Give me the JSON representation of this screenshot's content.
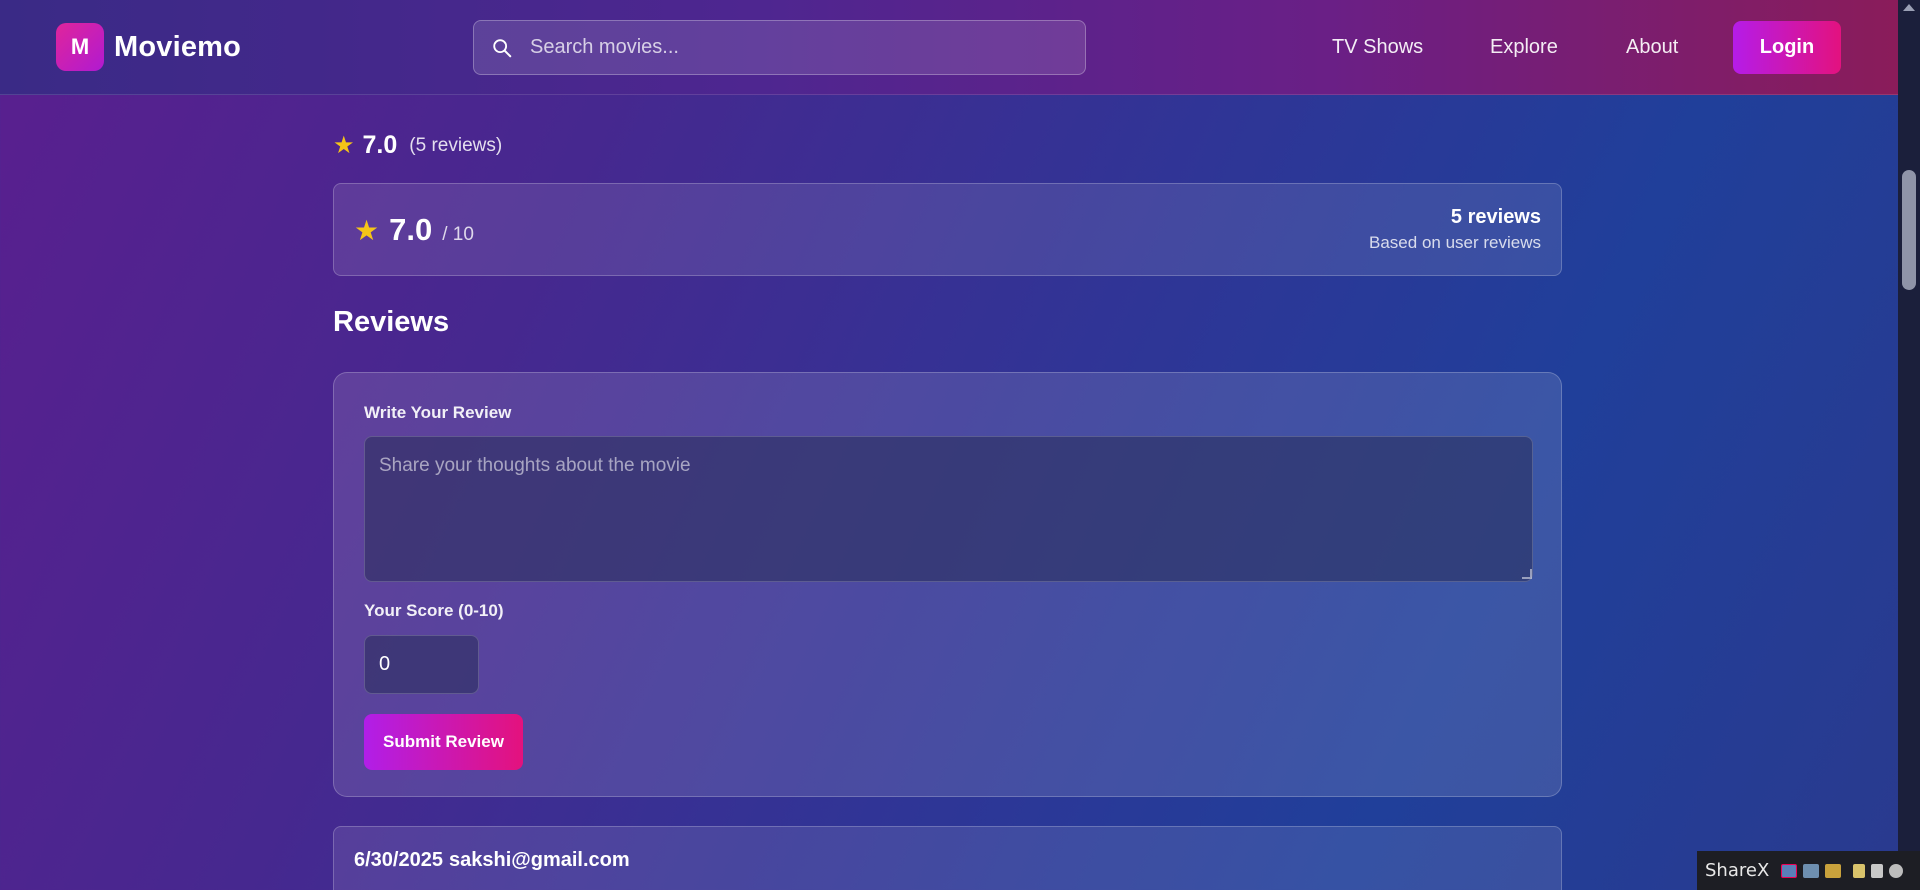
{
  "header": {
    "logo_letter": "M",
    "brand": "Moviemo",
    "search_placeholder": "Search movies...",
    "nav": [
      "TV Shows",
      "Explore",
      "About"
    ],
    "login_label": "Login"
  },
  "rating_summary": {
    "score": "7.0",
    "reviews_text": "(5 reviews)"
  },
  "rating_card": {
    "score": "7.0",
    "out_of": "/ 10",
    "count": "5 reviews",
    "subtitle": "Based on user reviews"
  },
  "reviews": {
    "title": "Reviews",
    "form": {
      "write_label": "Write Your Review",
      "review_placeholder": "Share your thoughts about the movie",
      "score_label": "Your Score (0-10)",
      "score_value": "0",
      "submit_label": "Submit Review"
    },
    "items": [
      {
        "date": "6/30/2025",
        "author": "sakshi@gmail.com"
      }
    ]
  },
  "taskbar": {
    "app_label": "ShareX"
  },
  "colors": {
    "accent_from": "#b11ee8",
    "accent_to": "#e4127d",
    "star": "#f5c518"
  }
}
